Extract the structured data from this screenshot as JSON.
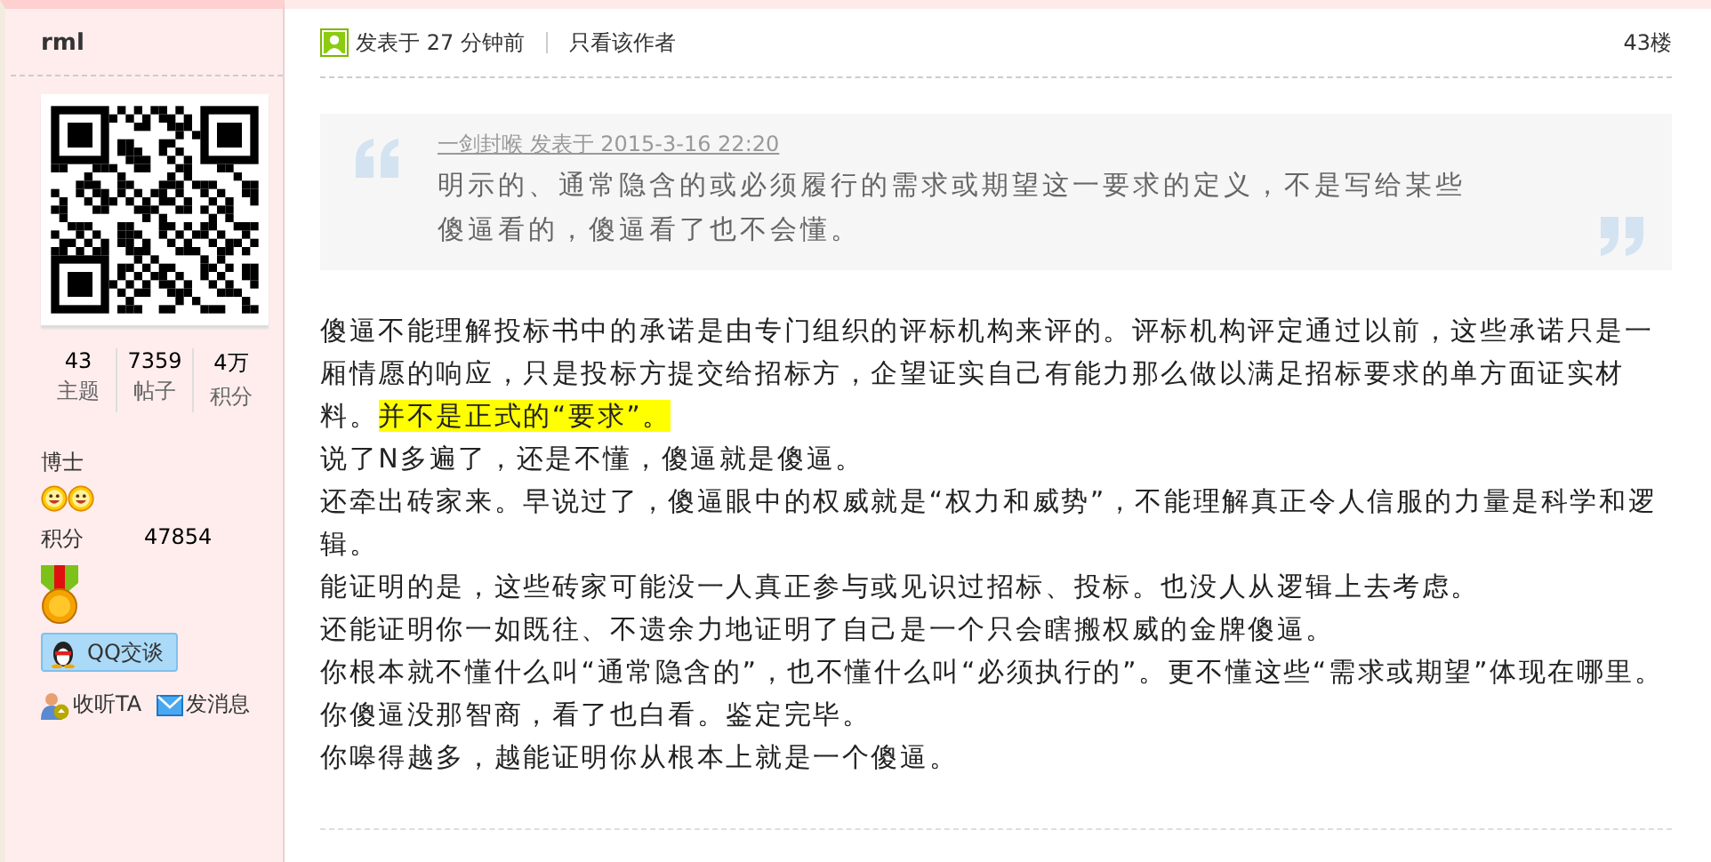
{
  "author": {
    "name": "rml",
    "stats": [
      {
        "value": "43",
        "label": "主题"
      },
      {
        "value": "7359",
        "label": "帖子"
      },
      {
        "value": "4万",
        "label": "积分"
      }
    ],
    "rank": "博士",
    "rank_icons": [
      {
        "kind": "smiley"
      },
      {
        "kind": "smiley"
      }
    ],
    "points_label": "积分",
    "points": "47854",
    "qq_button": "QQ交谈",
    "actions": [
      {
        "kind": "follow",
        "label": "收听TA"
      },
      {
        "kind": "message",
        "label": "发消息"
      }
    ]
  },
  "post": {
    "posted": "发表于 27 分钟前",
    "author_only": "只看该作者",
    "floor": "43楼",
    "quote": {
      "source": "一剑封喉 发表于 2015-3-16 22:20",
      "text": "明示的、通常隐含的或必须履行的需求或期望这一要求的定义，不是写给某些傻逼看的，傻逼看了也不会懂。"
    },
    "paragraphs": [
      [
        {
          "text": "傻逼不能理解投标书中的承诺是由专门组织的评标机构来评的。评标机构评定通过以前，这些承诺只是一厢情愿的响应，只是投标方提交给招标方，企望证实自己有能力那么做以满足招标要求的单方面证实材料。",
          "highlight": false
        },
        {
          "text": "并不是正式的“要求”。",
          "highlight": true
        }
      ],
      [
        {
          "text": "说了N多遍了，还是不懂，傻逼就是傻逼。",
          "highlight": false
        }
      ],
      [
        {
          "text": "还牵出砖家来。早说过了，傻逼眼中的权威就是“权力和威势”，不能理解真正令人信服的力量是科学和逻辑。",
          "highlight": false
        }
      ],
      [
        {
          "text": "能证明的是，这些砖家可能没一人真正参与或见识过招标、投标。也没人从逻辑上去考虑。",
          "highlight": false
        }
      ],
      [
        {
          "text": "还能证明你一如既往、不遗余力地证明了自己是一个只会瞎搬权威的金牌傻逼。",
          "highlight": false
        }
      ],
      [
        {
          "text": "你根本就不懂什么叫“通常隐含的”，也不懂什么叫“必须执行的”。更不懂这些“需求或期望”体现在哪里。你傻逼没那智商，看了也白看。鉴定完毕。",
          "highlight": false
        }
      ],
      [
        {
          "text": "你嗥得越多，越能证明你从根本上就是一个傻逼。",
          "highlight": false
        }
      ]
    ]
  }
}
